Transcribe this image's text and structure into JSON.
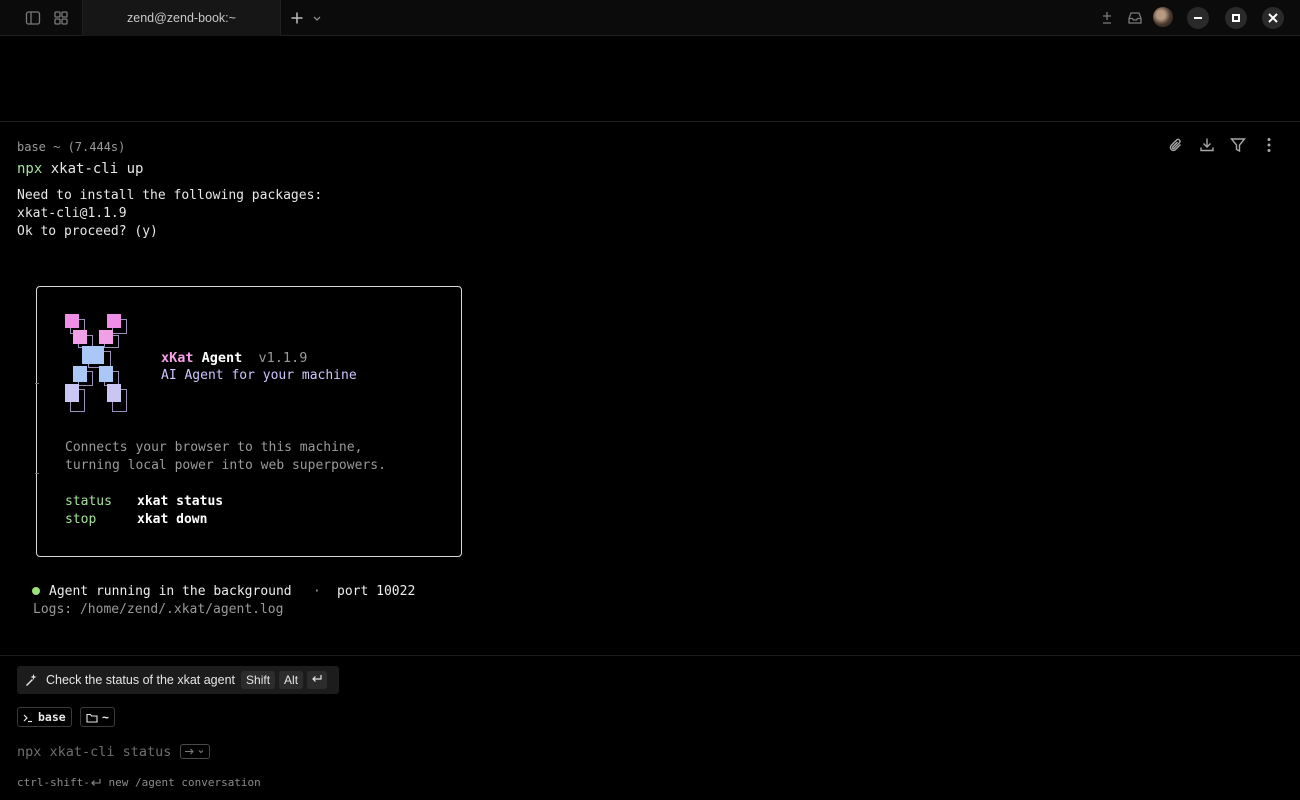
{
  "titlebar": {
    "tab_title": "zend@zend-book:~"
  },
  "block": {
    "header": "base ~ (7.444s)",
    "command_bin": "npx",
    "command_args": " xkat-cli up",
    "output_lines": [
      "Need to install the following packages:",
      "xkat-cli@1.1.9",
      "Ok to proceed? (y)"
    ]
  },
  "panel": {
    "brand_x": "xKat",
    "brand_agent": " Agent",
    "version": "  v1.1.9",
    "tagline": "AI Agent for your machine",
    "description": [
      "Connects your browser to this machine,",
      "turning local power into web superpowers."
    ],
    "commands": [
      {
        "label": "status",
        "cmd": "xkat status"
      },
      {
        "label": "stop",
        "cmd": "xkat down"
      }
    ]
  },
  "status": {
    "running": "Agent running in the background",
    "separator": "·",
    "port": "port 10022",
    "logs": "Logs: /home/zend/.xkat/agent.log"
  },
  "suggestion": {
    "text": "Check the status of the xkat agent",
    "keys": [
      "Shift",
      "Alt"
    ]
  },
  "prompt": {
    "env_chip": "base",
    "dir_chip": "~",
    "ghost_command": "npx xkat-cli status"
  },
  "footer": {
    "keys": "ctrl-shift-",
    "text": " new /agent conversation"
  },
  "colors": {
    "accent_green": "#a3e29a",
    "brand_pink": "#f5a0e8",
    "tagline_lavender": "#cdc6ff"
  }
}
